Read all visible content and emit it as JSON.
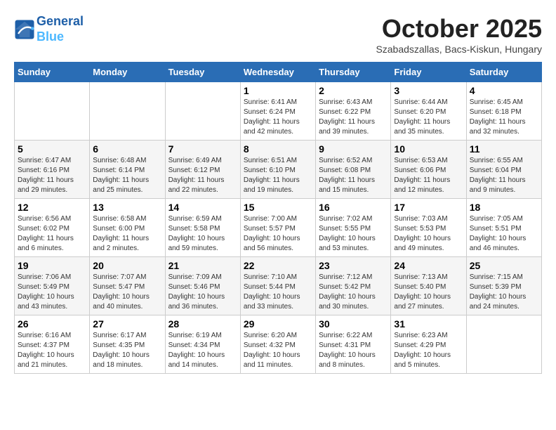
{
  "header": {
    "logo_line1": "General",
    "logo_line2": "Blue",
    "month": "October 2025",
    "location": "Szabadszallas, Bacs-Kiskun, Hungary"
  },
  "days_of_week": [
    "Sunday",
    "Monday",
    "Tuesday",
    "Wednesday",
    "Thursday",
    "Friday",
    "Saturday"
  ],
  "weeks": [
    [
      {
        "day": "",
        "info": ""
      },
      {
        "day": "",
        "info": ""
      },
      {
        "day": "",
        "info": ""
      },
      {
        "day": "1",
        "info": "Sunrise: 6:41 AM\nSunset: 6:24 PM\nDaylight: 11 hours\nand 42 minutes."
      },
      {
        "day": "2",
        "info": "Sunrise: 6:43 AM\nSunset: 6:22 PM\nDaylight: 11 hours\nand 39 minutes."
      },
      {
        "day": "3",
        "info": "Sunrise: 6:44 AM\nSunset: 6:20 PM\nDaylight: 11 hours\nand 35 minutes."
      },
      {
        "day": "4",
        "info": "Sunrise: 6:45 AM\nSunset: 6:18 PM\nDaylight: 11 hours\nand 32 minutes."
      }
    ],
    [
      {
        "day": "5",
        "info": "Sunrise: 6:47 AM\nSunset: 6:16 PM\nDaylight: 11 hours\nand 29 minutes."
      },
      {
        "day": "6",
        "info": "Sunrise: 6:48 AM\nSunset: 6:14 PM\nDaylight: 11 hours\nand 25 minutes."
      },
      {
        "day": "7",
        "info": "Sunrise: 6:49 AM\nSunset: 6:12 PM\nDaylight: 11 hours\nand 22 minutes."
      },
      {
        "day": "8",
        "info": "Sunrise: 6:51 AM\nSunset: 6:10 PM\nDaylight: 11 hours\nand 19 minutes."
      },
      {
        "day": "9",
        "info": "Sunrise: 6:52 AM\nSunset: 6:08 PM\nDaylight: 11 hours\nand 15 minutes."
      },
      {
        "day": "10",
        "info": "Sunrise: 6:53 AM\nSunset: 6:06 PM\nDaylight: 11 hours\nand 12 minutes."
      },
      {
        "day": "11",
        "info": "Sunrise: 6:55 AM\nSunset: 6:04 PM\nDaylight: 11 hours\nand 9 minutes."
      }
    ],
    [
      {
        "day": "12",
        "info": "Sunrise: 6:56 AM\nSunset: 6:02 PM\nDaylight: 11 hours\nand 6 minutes."
      },
      {
        "day": "13",
        "info": "Sunrise: 6:58 AM\nSunset: 6:00 PM\nDaylight: 11 hours\nand 2 minutes."
      },
      {
        "day": "14",
        "info": "Sunrise: 6:59 AM\nSunset: 5:58 PM\nDaylight: 10 hours\nand 59 minutes."
      },
      {
        "day": "15",
        "info": "Sunrise: 7:00 AM\nSunset: 5:57 PM\nDaylight: 10 hours\nand 56 minutes."
      },
      {
        "day": "16",
        "info": "Sunrise: 7:02 AM\nSunset: 5:55 PM\nDaylight: 10 hours\nand 53 minutes."
      },
      {
        "day": "17",
        "info": "Sunrise: 7:03 AM\nSunset: 5:53 PM\nDaylight: 10 hours\nand 49 minutes."
      },
      {
        "day": "18",
        "info": "Sunrise: 7:05 AM\nSunset: 5:51 PM\nDaylight: 10 hours\nand 46 minutes."
      }
    ],
    [
      {
        "day": "19",
        "info": "Sunrise: 7:06 AM\nSunset: 5:49 PM\nDaylight: 10 hours\nand 43 minutes."
      },
      {
        "day": "20",
        "info": "Sunrise: 7:07 AM\nSunset: 5:47 PM\nDaylight: 10 hours\nand 40 minutes."
      },
      {
        "day": "21",
        "info": "Sunrise: 7:09 AM\nSunset: 5:46 PM\nDaylight: 10 hours\nand 36 minutes."
      },
      {
        "day": "22",
        "info": "Sunrise: 7:10 AM\nSunset: 5:44 PM\nDaylight: 10 hours\nand 33 minutes."
      },
      {
        "day": "23",
        "info": "Sunrise: 7:12 AM\nSunset: 5:42 PM\nDaylight: 10 hours\nand 30 minutes."
      },
      {
        "day": "24",
        "info": "Sunrise: 7:13 AM\nSunset: 5:40 PM\nDaylight: 10 hours\nand 27 minutes."
      },
      {
        "day": "25",
        "info": "Sunrise: 7:15 AM\nSunset: 5:39 PM\nDaylight: 10 hours\nand 24 minutes."
      }
    ],
    [
      {
        "day": "26",
        "info": "Sunrise: 6:16 AM\nSunset: 4:37 PM\nDaylight: 10 hours\nand 21 minutes."
      },
      {
        "day": "27",
        "info": "Sunrise: 6:17 AM\nSunset: 4:35 PM\nDaylight: 10 hours\nand 18 minutes."
      },
      {
        "day": "28",
        "info": "Sunrise: 6:19 AM\nSunset: 4:34 PM\nDaylight: 10 hours\nand 14 minutes."
      },
      {
        "day": "29",
        "info": "Sunrise: 6:20 AM\nSunset: 4:32 PM\nDaylight: 10 hours\nand 11 minutes."
      },
      {
        "day": "30",
        "info": "Sunrise: 6:22 AM\nSunset: 4:31 PM\nDaylight: 10 hours\nand 8 minutes."
      },
      {
        "day": "31",
        "info": "Sunrise: 6:23 AM\nSunset: 4:29 PM\nDaylight: 10 hours\nand 5 minutes."
      },
      {
        "day": "",
        "info": ""
      }
    ]
  ]
}
